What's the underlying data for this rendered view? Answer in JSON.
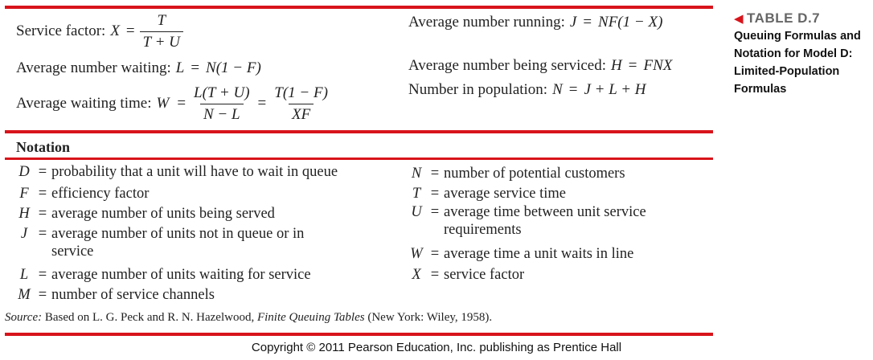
{
  "formulas": {
    "service_factor": {
      "label": "Service factor:",
      "lhs": "X",
      "eq": "=",
      "num": "T",
      "den": "T + U"
    },
    "avg_waiting": {
      "label": "Average number waiting:",
      "lhs": "L",
      "eq": "=",
      "rhs": "N(1 − F)"
    },
    "avg_wait_time": {
      "label": "Average waiting time:",
      "lhs": "W",
      "eq": "=",
      "num1": "L(T + U)",
      "den1": "N − L",
      "eq2": "=",
      "num2": "T(1 − F)",
      "den2": "XF"
    },
    "avg_running": {
      "label": "Average number running:",
      "lhs": "J",
      "eq": "=",
      "rhs": "NF(1 − X)"
    },
    "avg_serviced": {
      "label": "Average number being serviced:",
      "lhs": "H",
      "eq": "=",
      "rhs": "FNX"
    },
    "population": {
      "label": "Number in population:",
      "lhs": "N",
      "eq": "=",
      "rhs": "J + L + H"
    }
  },
  "notation": {
    "title": "Notation",
    "left": [
      {
        "sym": "D",
        "eq": "=",
        "desc": "probability that a unit will have to wait in queue"
      },
      {
        "sym": "F",
        "eq": "=",
        "desc": "efficiency factor"
      },
      {
        "sym": "H",
        "eq": "=",
        "desc": "average number of units being served"
      },
      {
        "sym": "J",
        "eq": "=",
        "desc": "average number of units not in queue or in service"
      },
      {
        "sym": "L",
        "eq": "=",
        "desc": "average number of units waiting for service"
      },
      {
        "sym": "M",
        "eq": "=",
        "desc": "number of service channels"
      }
    ],
    "right": [
      {
        "sym": "N",
        "eq": "=",
        "desc": "number of potential customers"
      },
      {
        "sym": "T",
        "eq": "=",
        "desc": "average service time"
      },
      {
        "sym": "U",
        "eq": "=",
        "desc": "average time between unit service requirements"
      },
      {
        "sym": "W",
        "eq": "=",
        "desc": "average time a unit waits in line"
      },
      {
        "sym": "X",
        "eq": "=",
        "desc": "service factor"
      }
    ]
  },
  "source": {
    "label": "Source:",
    "text_a": " Based on L. G. Peck and R. N. Hazelwood, ",
    "book": "Finite Queuing Tables",
    "text_b": " (New York: Wiley, 1958)."
  },
  "caption": {
    "arrow": "◀",
    "table_no": "TABLE D.7",
    "title": "Queuing Formulas and Notation for Model D: Limited-Population Formulas"
  },
  "copyright": "Copyright © 2011 Pearson Education, Inc. publishing as Prentice Hall",
  "colors": {
    "rule": "#d8141b",
    "caption_gray": "#666666"
  }
}
